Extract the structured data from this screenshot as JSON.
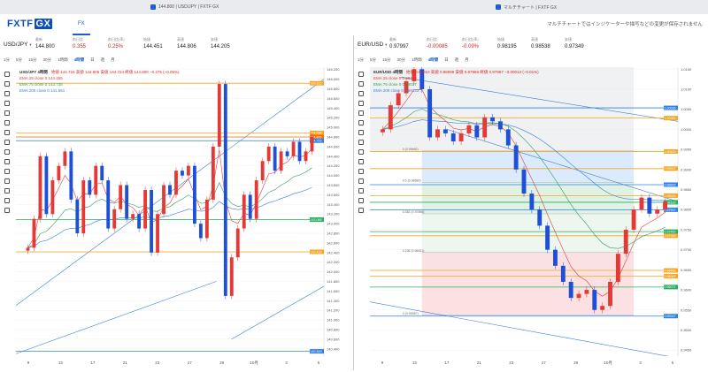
{
  "browser": {
    "tab_left": "144.800 | USD/JPY | FXTF GX",
    "tab_right": "マルチチャート | FXTF GX"
  },
  "header": {
    "logo_main": "FXTF",
    "logo_box": "GX",
    "nav_tab": "FX",
    "notice": "マルチチャートではインジケーターや描写などの変更が保存されません"
  },
  "panes": [
    {
      "symbol": "USD/JPY",
      "quote_labels": [
        "最新",
        "前日比",
        "前日比(率)",
        "始値",
        "高値",
        "安値"
      ],
      "quote_values": [
        "144.800",
        "0.355",
        "0.25%",
        "144.451",
        "144.806",
        "144.205"
      ],
      "timeframes": [
        "1分",
        "5分",
        "15分",
        "30分",
        "1時間",
        "4時間",
        "日",
        "週",
        "月"
      ],
      "active_tf": 5,
      "legend": {
        "title": "USD/JPY 4時間",
        "ohlc": "始値 144.724 高値 144.805 安値 144.724 終値 144.800 −0.275 (−0.05%)",
        "ema25": "EMA 25 close 0 144.455",
        "ema75": "EMA 75 close 0 143.738",
        "ema200": "EMA 200 close 0 141.551"
      }
    },
    {
      "symbol": "EUR/USD",
      "quote_labels": [
        "最新",
        "前日比",
        "前日比(率)",
        "始値",
        "高値",
        "安値"
      ],
      "quote_values": [
        "0.97997",
        "-0.00085",
        "-0.09%",
        "0.98195",
        "0.98538",
        "0.97349"
      ],
      "timeframes": [
        "1分",
        "5分",
        "15分",
        "30分",
        "1時間",
        "4時間",
        "日",
        "週",
        "月"
      ],
      "active_tf": 5,
      "legend": {
        "title": "EUR/USD 4時間",
        "ohlc": "始値 0.98010 高値 0.98099 安値 0.97986 終値 0.97997 −0.00013 (−0.01%)",
        "ema25": "EMA 25 close 0 0.98449",
        "ema75": "EMA 75 close 0 0.98037",
        "ema200": "EMA 200 close 0 0.99133"
      }
    }
  ],
  "chart_data": [
    {
      "type": "candlestick",
      "title": "USD/JPY 4時間",
      "ylim": [
        140.25,
        146.25
      ],
      "y_ticks": [
        140.4,
        140.6,
        140.8,
        141.0,
        141.2,
        141.4,
        141.6,
        141.8,
        142.0,
        142.2,
        142.4,
        142.6,
        142.8,
        143.0,
        143.2,
        143.4,
        143.6,
        143.8,
        144.0,
        144.2,
        144.4,
        144.6,
        144.8,
        145.0,
        145.2,
        145.4,
        145.6,
        145.8,
        146.0,
        146.2
      ],
      "x_ticks": [
        "9",
        "13",
        "17",
        "21",
        "23",
        "27",
        "29",
        "10月",
        "3",
        "5"
      ],
      "closes": [
        142.5,
        143.1,
        144.4,
        143.2,
        143.9,
        144.2,
        144.5,
        143.5,
        142.8,
        143.9,
        143.6,
        144.2,
        143.9,
        142.9,
        143.3,
        143.8,
        143.1,
        143.2,
        142.9,
        143.7,
        142.4,
        143.2,
        143.8,
        143.6,
        144.1,
        144.0,
        144.2,
        143.0,
        142.7,
        143.5,
        144.6,
        145.9,
        141.5,
        142.3,
        142.9,
        143.6,
        143.1,
        143.9,
        144.3,
        144.6,
        144.1,
        144.5,
        144.4,
        144.7,
        144.3,
        144.5,
        144.8
      ],
      "horizontal_lines": [
        {
          "value": 145.916,
          "color": "#f5a623"
        },
        {
          "value": 144.886,
          "color": "#f5a623"
        },
        {
          "value": 144.8,
          "color": "#ff6a00"
        },
        {
          "value": 144.723,
          "color": "#2f80ed"
        },
        {
          "value": 143.085,
          "color": "#27ae60"
        },
        {
          "value": 142.415,
          "color": "#f5a623"
        },
        {
          "value": 140.349,
          "color": "#2f80ed"
        }
      ],
      "price_labels": [
        "145.916",
        "144.886",
        "144.800",
        "144.723",
        "143.085",
        "142.415",
        "140.349"
      ]
    },
    {
      "type": "candlestick",
      "title": "EUR/USD 4時間",
      "ylim": [
        0.9435,
        1.0155
      ],
      "y_ticks": [
        0.945,
        0.95,
        0.955,
        0.96,
        0.965,
        0.97,
        0.975,
        0.98,
        0.985,
        0.99,
        0.995,
        1.0,
        1.005,
        1.01,
        1.015
      ],
      "x_ticks": [
        "9",
        "13",
        "17",
        "21",
        "23",
        "27",
        "29",
        "10月",
        "3",
        "5"
      ],
      "closes": [
        1.0,
        1.006,
        1.009,
        1.012,
        1.015,
        1.01,
        0.998,
        1.0,
        0.999,
        0.997,
        0.999,
        1.001,
        0.998,
        1.003,
        1.002,
        1.0,
        0.996,
        0.99,
        0.984,
        0.98,
        0.976,
        0.97,
        0.966,
        0.962,
        0.958,
        0.959,
        0.96,
        0.955,
        0.956,
        0.962,
        0.969,
        0.975,
        0.98,
        0.983,
        0.979,
        0.98,
        0.982
      ],
      "fib_levels": [
        {
          "label": "0 (0.99462)",
          "value": 0.99462
        },
        {
          "label": "0.5 (0.98680)",
          "value": 0.9868
        },
        {
          "label": "0.382 (0.97896)",
          "value": 0.97896
        },
        {
          "label": "0.236 (0.96931)",
          "value": 0.96931
        },
        {
          "label": "0 (0.95367)",
          "value": 0.95367
        }
      ],
      "horizontal_lines": [
        {
          "value": 1.00536,
          "color": "#2f80ed"
        },
        {
          "value": 1.00281,
          "color": "#f5a623"
        },
        {
          "value": 0.99449,
          "color": "#f5a623"
        },
        {
          "value": 0.99022,
          "color": "#f5a623"
        },
        {
          "value": 0.98622,
          "color": "#2f80ed"
        },
        {
          "value": 0.98349,
          "color": "#f5a623"
        },
        {
          "value": 0.98183,
          "color": "#27ae60"
        },
        {
          "value": 0.97997,
          "color": "#2f80ed"
        },
        {
          "value": 0.97452,
          "color": "#27ae60"
        },
        {
          "value": 0.97349,
          "color": "#f5a623"
        },
        {
          "value": 0.96485,
          "color": "#f5a623"
        },
        {
          "value": 0.96342,
          "color": "#f5a623"
        },
        {
          "value": 0.96071,
          "color": "#27ae60"
        },
        {
          "value": 0.95347,
          "color": "#2f80ed"
        }
      ],
      "price_labels": [
        "1.00536",
        "1.00281",
        "0.99449",
        "0.99022",
        "0.98622",
        "0.98349",
        "0.98183",
        "0.97997",
        "0.97452",
        "0.97349",
        "0.96485",
        "0.96342",
        "0.96071",
        "0.95347"
      ]
    }
  ]
}
